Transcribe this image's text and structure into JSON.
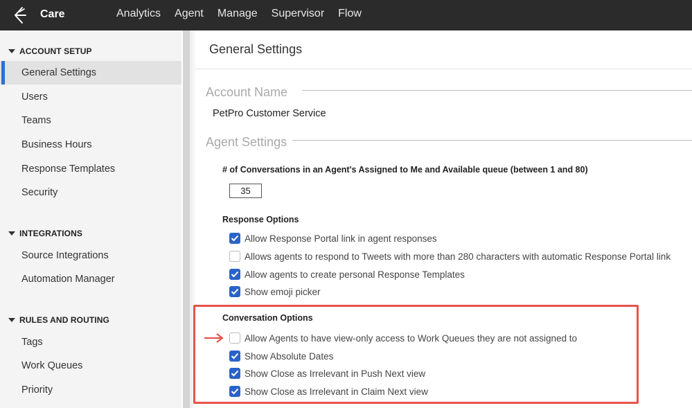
{
  "app": {
    "brand": "Care",
    "nav": [
      "Analytics",
      "Agent",
      "Manage",
      "Supervisor",
      "Flow"
    ]
  },
  "sidebar": {
    "sections": [
      {
        "title": "ACCOUNT SETUP",
        "items": [
          "General Settings",
          "Users",
          "Teams",
          "Business Hours",
          "Response Templates",
          "Security"
        ]
      },
      {
        "title": "INTEGRATIONS",
        "items": [
          "Source Integrations",
          "Automation Manager"
        ]
      },
      {
        "title": "RULES AND ROUTING",
        "items": [
          "Tags",
          "Work Queues",
          "Priority"
        ]
      }
    ],
    "active_item": "General Settings"
  },
  "main": {
    "page_title": "General Settings",
    "account_name": {
      "legend": "Account Name",
      "value": "PetPro Customer Service"
    },
    "agent_settings": {
      "legend": "Agent Settings",
      "queue_label": "# of Conversations in an Agent's Assigned to Me and Available queue (between 1 and 80)",
      "queue_value": "35",
      "response_options": {
        "label": "Response Options",
        "options": [
          {
            "label": "Allow Response Portal link in agent responses",
            "checked": true
          },
          {
            "label": "Allows agents to respond to Tweets with more than 280 characters with automatic Response Portal link",
            "checked": false
          },
          {
            "label": "Allow agents to create personal Response Templates",
            "checked": true
          },
          {
            "label": "Show emoji picker",
            "checked": true
          }
        ]
      },
      "conversation_options": {
        "label": "Conversation Options",
        "options": [
          {
            "label": "Allow Agents to have view-only access to Work Queues they are not assigned to",
            "checked": false
          },
          {
            "label": "Show Absolute Dates",
            "checked": true
          },
          {
            "label": "Show Close as Irrelevant in Push Next view",
            "checked": true
          },
          {
            "label": "Show Close as Irrelevant in Claim Next view",
            "checked": true
          }
        ]
      }
    }
  },
  "colors": {
    "topbar": "#2b2b2b",
    "accent": "#2a63c8",
    "highlight": "#e8534b"
  }
}
